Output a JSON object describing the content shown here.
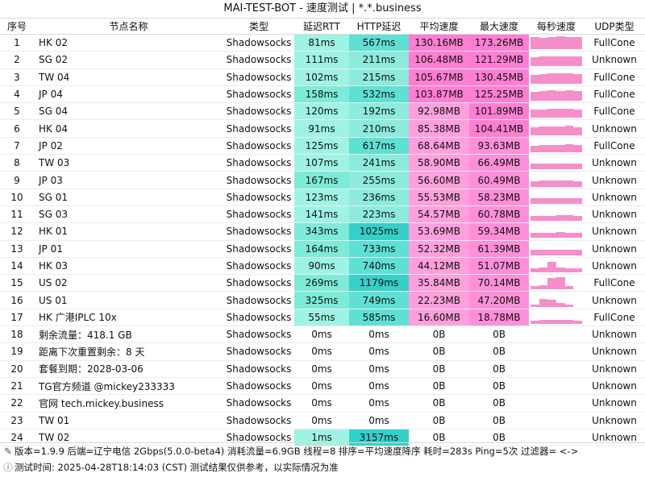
{
  "title": "MAI-TEST-BOT - 速度测试 | *.*.business",
  "headers": [
    "序号",
    "节点名称",
    "类型",
    "延迟RTT",
    "HTTP延迟",
    "平均速度",
    "最大速度",
    "每秒速度",
    "UDP类型"
  ],
  "colors": {
    "rtt_light": "#9ff3e4",
    "rtt_mid": "#7debd8",
    "http_light": "#8cebdc",
    "http_mid": "#5ee0d4",
    "http_dark": "#34d0c9",
    "avg_pink": "#ff7ed3",
    "avg_light": "#ff9fdd",
    "max_pink": "#ff8fd8",
    "spark": "#f48fc9"
  },
  "rows": [
    {
      "idx": "1",
      "name": "HK 02",
      "type": "Shadowsocks",
      "rtt": "81ms",
      "http": "567ms",
      "avg": "130.16MB",
      "max": "173.26MB",
      "spark": [
        0.95,
        0.9,
        0.95,
        1.0,
        0.95,
        0.95
      ],
      "udp": "FullCone"
    },
    {
      "idx": "2",
      "name": "SG 02",
      "type": "Shadowsocks",
      "rtt": "111ms",
      "http": "211ms",
      "avg": "106.48MB",
      "max": "121.29MB",
      "spark": [
        0.7,
        0.75,
        0.75,
        0.8,
        0.75,
        0.75
      ],
      "udp": "Unknown"
    },
    {
      "idx": "3",
      "name": "TW 04",
      "type": "Shadowsocks",
      "rtt": "102ms",
      "http": "215ms",
      "avg": "105.67MB",
      "max": "130.45MB",
      "spark": [
        0.7,
        0.75,
        0.8,
        0.8,
        0.8,
        0.75
      ],
      "udp": "FullCone"
    },
    {
      "idx": "4",
      "name": "JP 04",
      "type": "Shadowsocks",
      "rtt": "158ms",
      "http": "532ms",
      "avg": "103.87MB",
      "max": "125.25MB",
      "spark": [
        0.7,
        0.75,
        0.8,
        0.75,
        0.8,
        0.75
      ],
      "udp": "FullCone"
    },
    {
      "idx": "5",
      "name": "SG 04",
      "type": "Shadowsocks",
      "rtt": "120ms",
      "http": "192ms",
      "avg": "92.98MB",
      "max": "101.89MB",
      "spark": [
        0.65,
        0.65,
        0.7,
        0.7,
        0.7,
        0.65
      ],
      "udp": "FullCone"
    },
    {
      "idx": "6",
      "name": "HK 04",
      "type": "Shadowsocks",
      "rtt": "91ms",
      "http": "210ms",
      "avg": "85.38MB",
      "max": "104.41MB",
      "spark": [
        0.6,
        0.65,
        0.65,
        0.65,
        0.7,
        0.6
      ],
      "udp": "Unknown"
    },
    {
      "idx": "7",
      "name": "JP 02",
      "type": "Shadowsocks",
      "rtt": "125ms",
      "http": "617ms",
      "avg": "68.64MB",
      "max": "93.63MB",
      "spark": [
        0.5,
        0.55,
        0.55,
        0.55,
        0.6,
        0.55
      ],
      "udp": "FullCone"
    },
    {
      "idx": "8",
      "name": "TW 03",
      "type": "Shadowsocks",
      "rtt": "107ms",
      "http": "241ms",
      "avg": "58.90MB",
      "max": "66.49MB",
      "spark": [
        0.45,
        0.45,
        0.45,
        0.45,
        0.45,
        0.45
      ],
      "udp": "Unknown"
    },
    {
      "idx": "9",
      "name": "JP 03",
      "type": "Shadowsocks",
      "rtt": "167ms",
      "http": "255ms",
      "avg": "56.60MB",
      "max": "60.49MB",
      "spark": [
        0.4,
        0.45,
        0.45,
        0.45,
        0.45,
        0.4
      ],
      "udp": "Unknown"
    },
    {
      "idx": "10",
      "name": "SG 01",
      "type": "Shadowsocks",
      "rtt": "123ms",
      "http": "236ms",
      "avg": "55.53MB",
      "max": "58.23MB",
      "spark": [
        0.4,
        0.4,
        0.45,
        0.4,
        0.45,
        0.4
      ],
      "udp": "Unknown"
    },
    {
      "idx": "11",
      "name": "SG 03",
      "type": "Shadowsocks",
      "rtt": "141ms",
      "http": "223ms",
      "avg": "54.57MB",
      "max": "60.78MB",
      "spark": [
        0.4,
        0.4,
        0.4,
        0.45,
        0.45,
        0.4
      ],
      "udp": "Unknown"
    },
    {
      "idx": "12",
      "name": "HK 01",
      "type": "Shadowsocks",
      "rtt": "343ms",
      "http": "1025ms",
      "avg": "53.69MB",
      "max": "59.34MB",
      "spark": [
        0.4,
        0.4,
        0.4,
        0.45,
        0.4,
        0.4
      ],
      "udp": "Unknown"
    },
    {
      "idx": "13",
      "name": "JP 01",
      "type": "Shadowsocks",
      "rtt": "164ms",
      "http": "733ms",
      "avg": "52.32MB",
      "max": "61.39MB",
      "spark": [
        0.4,
        0.4,
        0.45,
        0.4,
        0.4,
        0.4
      ],
      "udp": "Unknown"
    },
    {
      "idx": "14",
      "name": "HK 03",
      "type": "Shadowsocks",
      "rtt": "90ms",
      "http": "740ms",
      "avg": "44.12MB",
      "max": "51.07MB",
      "spark": [
        0.3,
        0.35,
        0.8,
        0.35,
        0.3,
        0.3
      ],
      "udp": "Unknown"
    },
    {
      "idx": "15",
      "name": "US 02",
      "type": "Shadowsocks",
      "rtt": "269ms",
      "http": "1179ms",
      "avg": "35.84MB",
      "max": "70.14MB",
      "spark": [
        0.3,
        0.35,
        0.9,
        0.95,
        0.3,
        0.0
      ],
      "udp": "FullCone"
    },
    {
      "idx": "16",
      "name": "US 01",
      "type": "Shadowsocks",
      "rtt": "325ms",
      "http": "749ms",
      "avg": "22.23MB",
      "max": "47.20MB",
      "spark": [
        0.15,
        0.6,
        0.55,
        0.3,
        0.15,
        0.0
      ],
      "udp": "Unknown"
    },
    {
      "idx": "17",
      "name": "HK 广港IPLC 10x",
      "type": "Shadowsocks",
      "rtt": "55ms",
      "http": "585ms",
      "avg": "16.60MB",
      "max": "18.78MB",
      "spark": [
        0.25,
        0.3,
        0.3,
        0.3,
        0.3,
        0.25
      ],
      "udp": "FullCone"
    },
    {
      "idx": "18",
      "name": "剩余流量：418.1 GB",
      "type": "Shadowsocks",
      "rtt": "0ms",
      "http": "0ms",
      "avg": "0B",
      "max": "0B",
      "spark": [],
      "udp": "Unknown"
    },
    {
      "idx": "19",
      "name": "距离下次重置剩余：8 天",
      "type": "Shadowsocks",
      "rtt": "0ms",
      "http": "0ms",
      "avg": "0B",
      "max": "0B",
      "spark": [],
      "udp": "Unknown"
    },
    {
      "idx": "20",
      "name": "套餐到期：2028-03-06",
      "type": "Shadowsocks",
      "rtt": "0ms",
      "http": "0ms",
      "avg": "0B",
      "max": "0B",
      "spark": [],
      "udp": "Unknown"
    },
    {
      "idx": "21",
      "name": "TG官方频道 @mickey233333",
      "type": "Shadowsocks",
      "rtt": "0ms",
      "http": "0ms",
      "avg": "0B",
      "max": "0B",
      "spark": [],
      "udp": "Unknown"
    },
    {
      "idx": "22",
      "name": "官网 tech.mickey.business",
      "type": "Shadowsocks",
      "rtt": "0ms",
      "http": "0ms",
      "avg": "0B",
      "max": "0B",
      "spark": [],
      "udp": "Unknown"
    },
    {
      "idx": "23",
      "name": "TW 01",
      "type": "Shadowsocks",
      "rtt": "0ms",
      "http": "0ms",
      "avg": "0B",
      "max": "0B",
      "spark": [],
      "udp": "Unknown"
    },
    {
      "idx": "24",
      "name": "TW 02",
      "type": "Shadowsocks",
      "rtt": "1ms",
      "http": "3157ms",
      "avg": "0B",
      "max": "0B",
      "spark": [],
      "udp": "Unknown"
    }
  ],
  "footer": {
    "version_icon": "pencil-icon",
    "line1": "版本=1.9.9  后端=辽宁电信 2Gbps(5.0.0-beta4) 消耗流量=6.9GB  线程=8  排序=平均速度降序  耗时=283s  Ping=5次  过滤器= <->",
    "info_icon": "info-icon",
    "line2": "测试时间: 2025-04-28T18:14:03 (CST)  测试结果仅供参考，以实际情况为准"
  }
}
